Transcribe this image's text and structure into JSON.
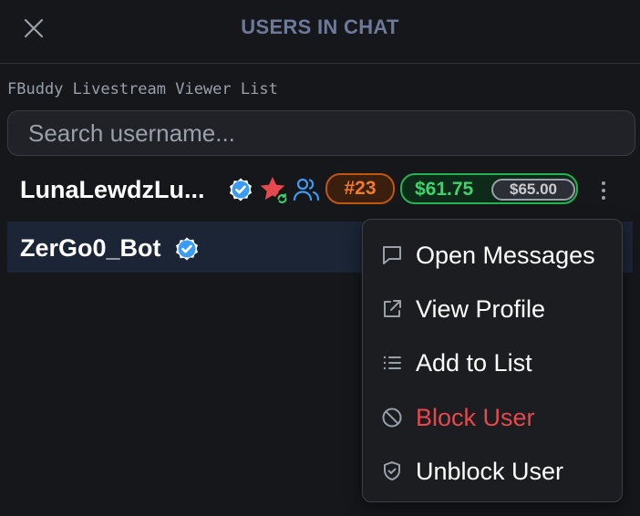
{
  "header": {
    "title": "USERS IN CHAT"
  },
  "list_label": "FBuddy Livestream Viewer List",
  "search": {
    "placeholder": "Search username...",
    "value": ""
  },
  "users": [
    {
      "name": "LunaLewdzLu...",
      "rank": "#23",
      "amount": "$61.75",
      "amount_secondary": "$65.00"
    },
    {
      "name": "ZerGo0_Bot"
    }
  ],
  "menu": {
    "items": [
      {
        "label": "Open Messages",
        "icon": "message-square-icon"
      },
      {
        "label": "View Profile",
        "icon": "external-link-icon"
      },
      {
        "label": "Add to List",
        "icon": "list-icon"
      },
      {
        "label": "Block User",
        "icon": "ban-icon",
        "color": "#e5484d"
      },
      {
        "label": "Unblock User",
        "icon": "shield-check-icon"
      }
    ]
  },
  "colors": {
    "background": "#16171b",
    "verified": "#3b9cf5",
    "star": "#e5484d",
    "rank_badge": "#ef7b2c",
    "money_badge": "#3fd46b",
    "danger": "#e5484d"
  }
}
